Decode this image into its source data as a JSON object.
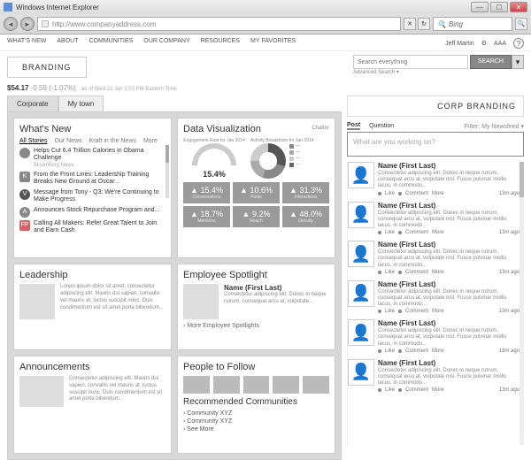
{
  "window": {
    "title": "Windows Internet Explorer"
  },
  "browser": {
    "url": "http://www.companyaddress.com",
    "search_provider": "Bing"
  },
  "menubar": {
    "items": [
      "WHAT'S NEW",
      "ABOUT",
      "COMMUNITIES",
      "OUR COMPANY",
      "RESOURCES",
      "MY FAVORITES"
    ],
    "user": "Jeff Martin",
    "text_size": "AAA"
  },
  "branding": {
    "label": "BRANDING"
  },
  "site_search": {
    "placeholder": "Search everything",
    "button": "SEARCH",
    "advanced": "Advanced Search ▾"
  },
  "stock": {
    "price": "$54.17",
    "change": "-0.59 (-1.07%)",
    "asof": "as of Wed 22 Jan 1:03 PM Eastern Time"
  },
  "tabs": {
    "corporate": "Corporate",
    "mytown": "My town"
  },
  "whats_new": {
    "title": "What's New",
    "subtabs": [
      "All Stories",
      "Our News",
      "Kraft in the News",
      "More"
    ],
    "items": [
      {
        "badge": "",
        "title": "Helps Cut 6.4 Trillion Calories in Obama Challenge",
        "src": "Bloomberg News"
      },
      {
        "badge": "K",
        "title": "From the Front Lines: Leadership Training Breaks New Ground at Oscar..."
      },
      {
        "badge": "V",
        "title": "Message from Tony - Q3: We're Continuing to Make Progress"
      },
      {
        "badge": "A",
        "title": "Announces Stock Repurchase Program and..."
      },
      {
        "badge": "FP",
        "title": "Calling All Makers: Refer Great Talent to Join and Earn Cash"
      }
    ]
  },
  "dataviz": {
    "title": "Data Visualization",
    "chatter": "Chatter",
    "gauge_label": "Engagement Rate for Jan 2014",
    "gauge_value": "15.4%",
    "pie_label": "Activity Breakdown for Jan 2014",
    "metrics": [
      {
        "v": "▲ 15.4%",
        "l": "Conversations"
      },
      {
        "v": "▲ 10.6%",
        "l": "Posts"
      },
      {
        "v": "▲ 31.3%",
        "l": "Interactions"
      },
      {
        "v": "▲ 18.7%",
        "l": "Mentions"
      },
      {
        "v": "▲ 9.2%",
        "l": "Reach"
      },
      {
        "v": "▲ 48.0%",
        "l": "Density"
      }
    ]
  },
  "leadership": {
    "title": "Leadership",
    "body": "Lorem ipsum dolor sit amet, consectetur adipiscing elit. Mauris dui sapien, convallis vel mauris at, luctus suscipit nunc. Duis condimentum est sit amet porta bibendum..."
  },
  "spotlight": {
    "title": "Employee Spotlight",
    "name": "Name (First Last)",
    "body": "Consectetur adipiscing elit. Donec in neque rutrum, consequat arcu at, vulputate...",
    "link": "› More Employee Spotlights"
  },
  "announcements": {
    "title": "Announcements",
    "body": "Consectetur adipiscing elit. Mauris dui sapien, convallis vel mauris at, luctus suscipit nunc. Duis condimentum est sit amet porta bibendum..."
  },
  "people_to_follow": {
    "title": "People to Follow",
    "rec_title": "Recommended Communities",
    "links": [
      "› Community XYZ",
      "› Community XYZ",
      "› See More"
    ]
  },
  "sidebar": {
    "brand": "CORP BRANDING",
    "post": "Post",
    "question": "Question",
    "filter": "Filter: My Newsfeed ▾",
    "composer_placeholder": "What are you working on?",
    "post_template": {
      "name": "Name (First Last)",
      "body": "Consectetur adipiscing elit. Donec in neque rutrum, consequat arcu at, vulputate nisl. Fusce pulvinar mollis lacus, in commodo...",
      "like": "Like",
      "comment": "Comment",
      "more": "More",
      "time": "13m ago"
    }
  },
  "chart_data": {
    "type": "bar",
    "title": "Data Visualization metrics",
    "categories": [
      "Conversations",
      "Posts",
      "Interactions",
      "Mentions",
      "Reach",
      "Density"
    ],
    "values": [
      15.4,
      10.6,
      31.3,
      18.7,
      9.2,
      48.0
    ],
    "gauge": {
      "label": "Engagement Rate for Jan 2014",
      "value": 15.4,
      "unit": "%"
    }
  }
}
